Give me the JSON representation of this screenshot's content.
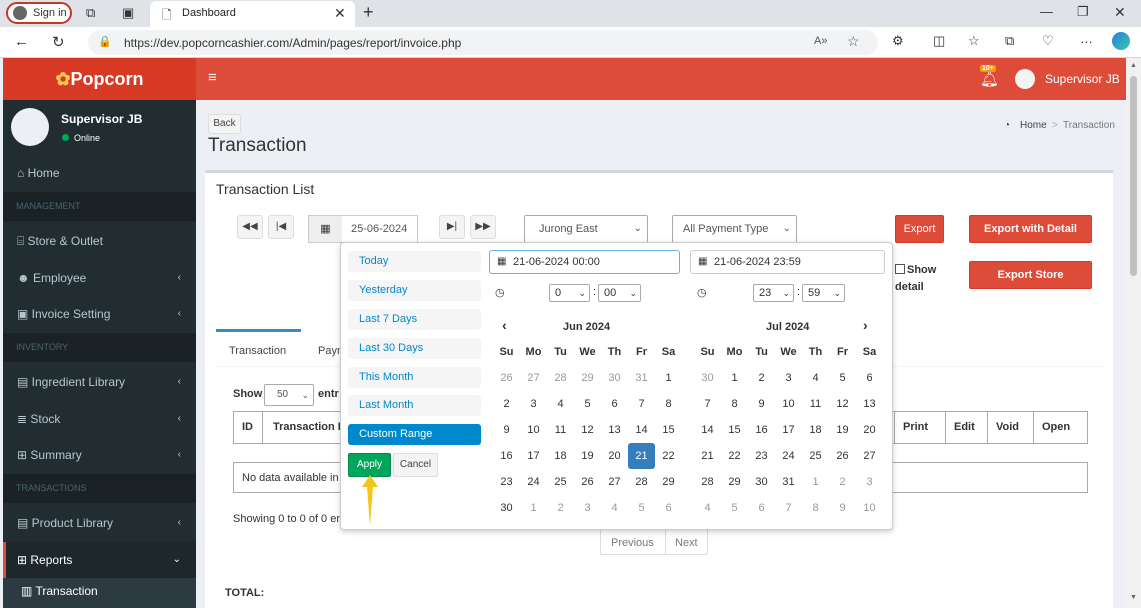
{
  "browser": {
    "signin_label": "Sign in",
    "tab_title": "Dashboard",
    "url": "https://dev.popcorncashier.com/Admin/pages/report/invoice.php"
  },
  "header": {
    "logo": "Popcorn",
    "badge": "10+",
    "user": "Supervisor JB"
  },
  "sidebar": {
    "user_name": "Supervisor JB",
    "status": "Online",
    "items": {
      "home": "Home",
      "management": "MANAGEMENT",
      "store": "Store & Outlet",
      "employee": "Employee",
      "invoice_setting": "Invoice Setting",
      "inventory": "INVENTORY",
      "ingredient": "Ingredient Library",
      "stock": "Stock",
      "summary": "Summary",
      "transactions": "TRANSACTIONS",
      "product": "Product Library",
      "reports": "Reports",
      "transaction": "Transaction"
    }
  },
  "page": {
    "back": "Back",
    "title": "Transaction",
    "breadcrumb_home": "Home",
    "breadcrumb_current": "Transaction",
    "box_title": "Transaction List",
    "date": "25-06-2024",
    "outlet": "Jurong East",
    "payment": "All Payment Type",
    "export": "Export",
    "export_detail": "Export with Detail",
    "export_store": "Export Store",
    "show_detail_1": "Show",
    "show_detail_2": "detail",
    "tab_transaction": "Transaction",
    "tab_payment": "Payn",
    "show_label": "Show",
    "show_value": "50",
    "entries_label": "entr",
    "col_id": "ID",
    "col_transaction": "Transaction D",
    "col_print": "Print",
    "col_edit": "Edit",
    "col_void": "Void",
    "col_open": "Open",
    "empty": "No data available in",
    "showing": "Showing 0 to 0 of 0 en",
    "previous": "Previous",
    "next": "Next",
    "total": "TOTAL:"
  },
  "picker": {
    "ranges": [
      "Today",
      "Yesterday",
      "Last 7 Days",
      "Last 30 Days",
      "This Month",
      "Last Month",
      "Custom Range"
    ],
    "apply": "Apply",
    "cancel": "Cancel",
    "start": "21-06-2024 00:00",
    "end": "21-06-2024 23:59",
    "start_hour": "0",
    "start_min": "00",
    "end_hour": "23",
    "end_min": "59",
    "left_month": "Jun 2024",
    "right_month": "Jul 2024",
    "weekdays": [
      "Su",
      "Mo",
      "Tu",
      "We",
      "Th",
      "Fr",
      "Sa"
    ],
    "left_weeks": [
      [
        "26",
        "27",
        "28",
        "29",
        "30",
        "31",
        "1"
      ],
      [
        "2",
        "3",
        "4",
        "5",
        "6",
        "7",
        "8"
      ],
      [
        "9",
        "10",
        "11",
        "12",
        "13",
        "14",
        "15"
      ],
      [
        "16",
        "17",
        "18",
        "19",
        "20",
        "21",
        "22"
      ],
      [
        "23",
        "24",
        "25",
        "26",
        "27",
        "28",
        "29"
      ],
      [
        "30",
        "1",
        "2",
        "3",
        "4",
        "5",
        "6"
      ]
    ],
    "right_weeks": [
      [
        "30",
        "1",
        "2",
        "3",
        "4",
        "5",
        "6"
      ],
      [
        "7",
        "8",
        "9",
        "10",
        "11",
        "12",
        "13"
      ],
      [
        "14",
        "15",
        "16",
        "17",
        "18",
        "19",
        "20"
      ],
      [
        "21",
        "22",
        "23",
        "24",
        "25",
        "26",
        "27"
      ],
      [
        "28",
        "29",
        "30",
        "31",
        "1",
        "2",
        "3"
      ],
      [
        "4",
        "5",
        "6",
        "7",
        "8",
        "9",
        "10"
      ]
    ],
    "selected_day": "21"
  },
  "colors": {
    "brand": "#dd4b39",
    "sidebar": "#222d32",
    "highlight": "#357ebd",
    "apply": "#00a65a",
    "arrow": "#f5c518"
  }
}
